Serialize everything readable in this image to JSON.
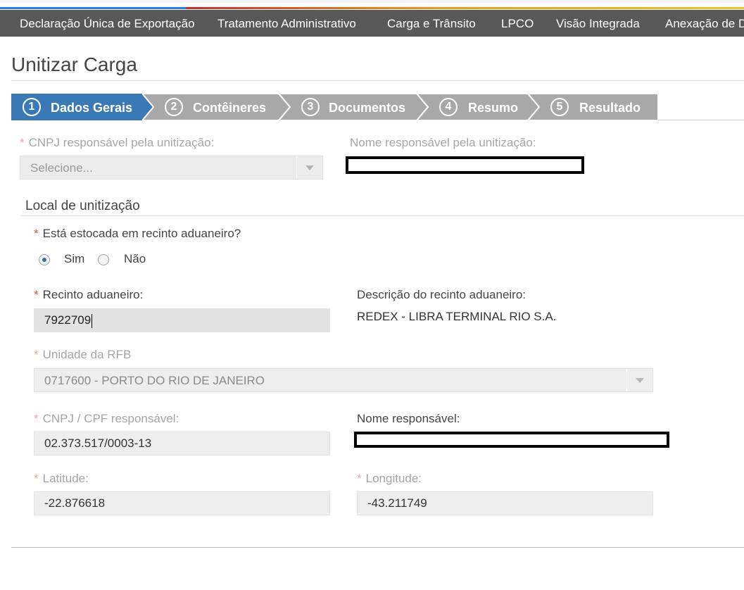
{
  "topnav": {
    "items": [
      {
        "label": "Declaração Única de Exportação"
      },
      {
        "label": "Tratamento Administrativo"
      },
      {
        "label": "Carga e Trânsito"
      },
      {
        "label": "LPCO"
      },
      {
        "label": "Visão Integrada"
      },
      {
        "label": "Anexação de D"
      }
    ]
  },
  "page": {
    "title": "Unitizar Carga"
  },
  "wizard": {
    "steps": [
      {
        "num": "1",
        "label": "Dados Gerais",
        "state": "active",
        "color": "#3a78b6"
      },
      {
        "num": "2",
        "label": "Contêineres",
        "state": "inactive",
        "color": "#a8a8a8"
      },
      {
        "num": "3",
        "label": "Documentos",
        "state": "inactive",
        "color": "#a8a8a8"
      },
      {
        "num": "4",
        "label": "Resumo",
        "state": "inactive",
        "color": "#a8a8a8"
      },
      {
        "num": "5",
        "label": "Resultado",
        "state": "inactive",
        "color": "#a8a8a8"
      }
    ]
  },
  "form": {
    "cnpj_unitizacao": {
      "label": "CNPJ responsável pela unitização:",
      "required": "*",
      "placeholder": "Selecione..."
    },
    "nome_unitizacao": {
      "label": "Nome responsável pela unitização:"
    },
    "section_local": "Local de unitização",
    "estocada": {
      "label": "Está estocada em recinto aduaneiro?",
      "required": "*",
      "options": [
        {
          "label": "Sim",
          "checked": true
        },
        {
          "label": "Não",
          "checked": false
        }
      ]
    },
    "recinto": {
      "label": "Recinto aduaneiro:",
      "required": "*",
      "value": "7922709"
    },
    "descricao_recinto": {
      "label": "Descrição do recinto aduaneiro:",
      "value": "REDEX - LIBRA TERMINAL RIO S.A."
    },
    "unidade_rfb": {
      "label": "Unidade da RFB",
      "required": "*",
      "value": "0717600 - PORTO DO RIO DE JANEIRO"
    },
    "cnpj_cpf": {
      "label": "CNPJ / CPF responsável:",
      "required": "*",
      "value": "02.373.517/0003-13"
    },
    "nome_responsavel": {
      "label": "Nome responsável:"
    },
    "latitude": {
      "label": "Latitude:",
      "required": "*",
      "value": "-22.876618"
    },
    "longitude": {
      "label": "Longitude:",
      "required": "*",
      "value": "-43.211749"
    }
  },
  "colors": {
    "accent": "#3a78b6",
    "nav_bg": "#585858",
    "required": "#d9534f"
  }
}
